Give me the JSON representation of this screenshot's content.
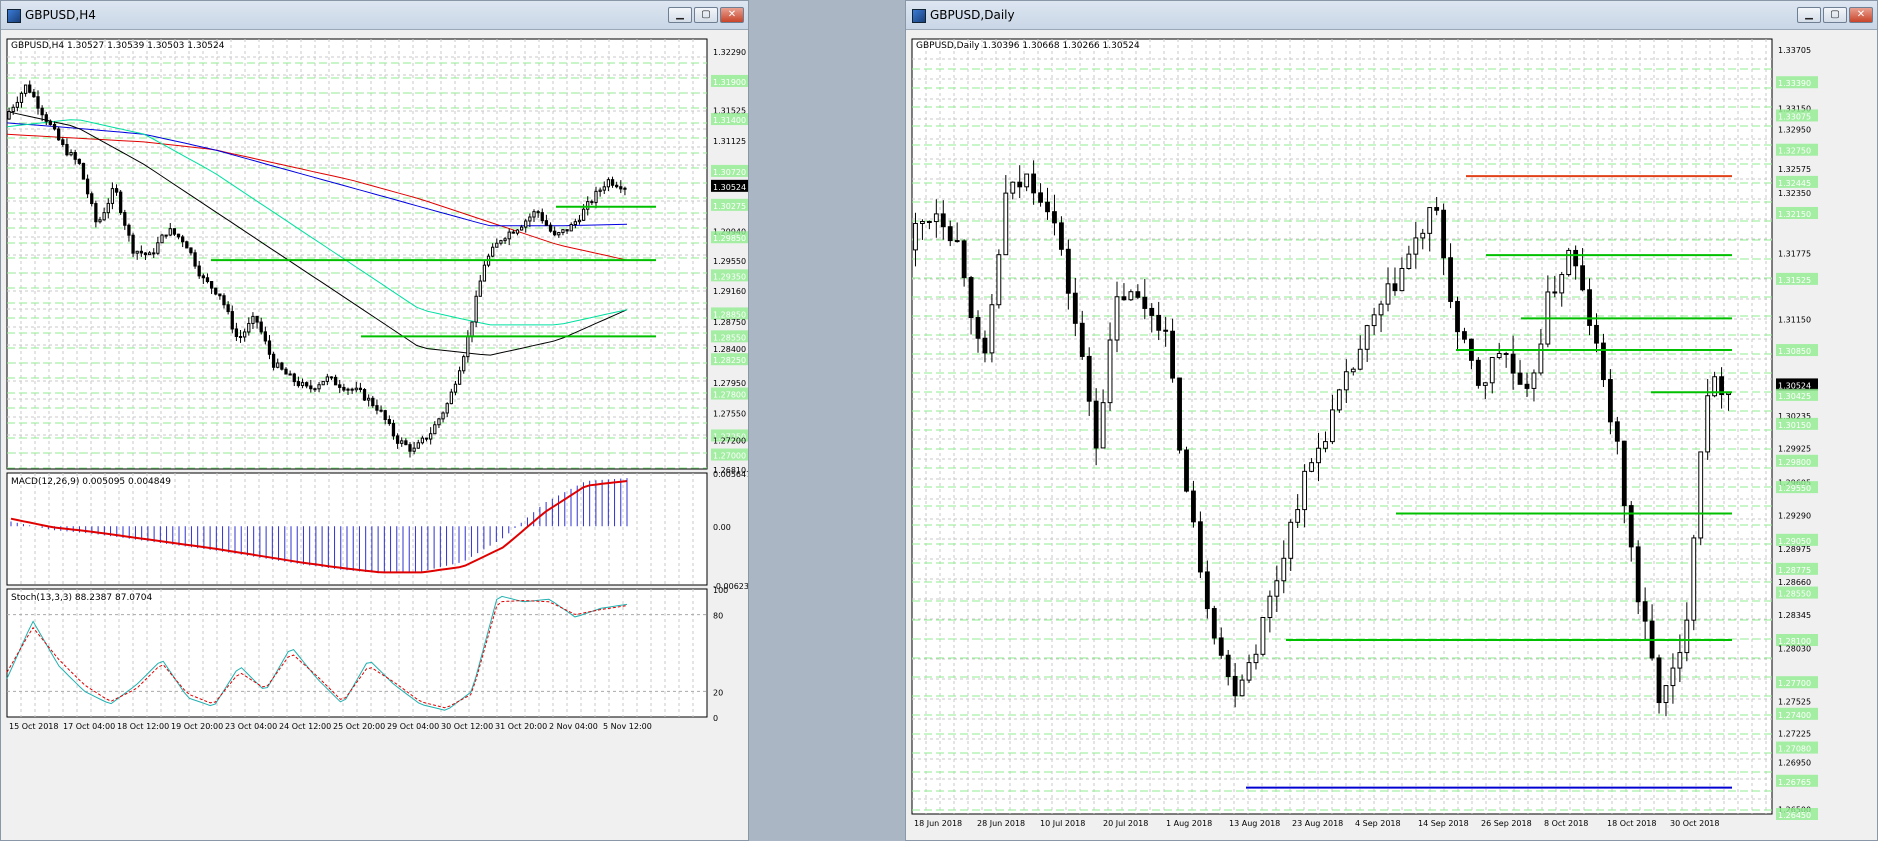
{
  "h4": {
    "title": "GBPUSD,H4",
    "header": "GBPUSD,H4  1.30527 1.30539 1.30503 1.30524",
    "price_axis": [
      "1.32290",
      "1.31900",
      "1.31525",
      "1.31400",
      "1.31125",
      "1.30720",
      "1.30524",
      "1.30275",
      "1.29940",
      "1.29850",
      "1.29550",
      "1.29350",
      "1.29160",
      "1.28850",
      "1.28750",
      "1.28550",
      "1.28400",
      "1.28250",
      "1.27950",
      "1.27800",
      "1.27550",
      "1.27250",
      "1.27200",
      "1.27000",
      "1.26810"
    ],
    "current_price": "1.30524",
    "time_axis": [
      "15 Oct 2018",
      "17 Oct 04:00",
      "18 Oct 12:00",
      "19 Oct 20:00",
      "23 Oct 04:00",
      "24 Oct 12:00",
      "25 Oct 20:00",
      "29 Oct 04:00",
      "30 Oct 12:00",
      "31 Oct 20:00",
      "2 Nov 04:00",
      "5 Nov 12:00"
    ],
    "macd_label": "MACD(12,26,9) 0.005095 0.004849",
    "macd_axis": [
      "0.005647",
      "0.00",
      "-0.006235"
    ],
    "stoch_label": "Stoch(13,3,3) 88.2387 87.0704",
    "stoch_axis": [
      "100",
      "80",
      "20",
      "0"
    ]
  },
  "daily": {
    "title": "GBPUSD,Daily",
    "header": "GBPUSD,Daily  1.30396 1.30668 1.30266 1.30524",
    "price_axis": [
      "1.33705",
      "1.33390",
      "1.33150",
      "1.33075",
      "1.32950",
      "1.32750",
      "1.32575",
      "1.32445",
      "1.32350",
      "1.32150",
      "1.31775",
      "1.31525",
      "1.31150",
      "1.30850",
      "1.30524",
      "1.30425",
      "1.30235",
      "1.30150",
      "1.29925",
      "1.29800",
      "1.29605",
      "1.29550",
      "1.29290",
      "1.29050",
      "1.28975",
      "1.28775",
      "1.28660",
      "1.28550",
      "1.28345",
      "1.28100",
      "1.28030",
      "1.27700",
      "1.27525",
      "1.27400",
      "1.27225",
      "1.27080",
      "1.26950",
      "1.26765",
      "1.26500",
      "1.26450"
    ],
    "current_price": "1.30524",
    "time_axis": [
      "18 Jun 2018",
      "28 Jun 2018",
      "10 Jul 2018",
      "20 Jul 2018",
      "1 Aug 2018",
      "13 Aug 2018",
      "23 Aug 2018",
      "4 Sep 2018",
      "14 Sep 2018",
      "26 Sep 2018",
      "8 Oct 2018",
      "18 Oct 2018",
      "30 Oct 2018"
    ]
  },
  "colors": {
    "chart_bg": "#ffffff",
    "grid": "#c8c8c8",
    "level_green": "#00c000",
    "band_green": "#90ee90",
    "resistance_red": "#e0401a",
    "support_blue": "#0000d0",
    "ma_red": "#e00000",
    "ma_blue": "#0000e0",
    "ma_black": "#000000",
    "ma_cyan": "#00e0a0",
    "macd_hist": "#3030d0",
    "macd_signal": "#e00000",
    "stoch_main": "#20b0b0",
    "stoch_signal": "#e00000"
  },
  "chart_data": [
    {
      "type": "candlestick",
      "title": "GBPUSD,H4",
      "ylim": [
        1.2681,
        1.3245
      ],
      "x": [
        "15 Oct 2018",
        "17 Oct 04:00",
        "18 Oct 12:00",
        "19 Oct 20:00",
        "23 Oct 04:00",
        "24 Oct 12:00",
        "25 Oct 20:00",
        "29 Oct 04:00",
        "30 Oct 12:00",
        "31 Oct 20:00",
        "2 Nov 04:00",
        "5 Nov 12:00"
      ],
      "close": [
        1.315,
        1.3185,
        1.3145,
        1.3105,
        1.308,
        1.3,
        1.305,
        1.297,
        1.296,
        1.2995,
        1.298,
        1.293,
        1.291,
        1.285,
        1.288,
        1.282,
        1.28,
        1.2785,
        1.28,
        1.279,
        1.278,
        1.276,
        1.272,
        1.2705,
        1.273,
        1.277,
        1.2845,
        1.295,
        1.2985,
        1.3,
        1.302,
        1.2985,
        1.3,
        1.303,
        1.306,
        1.3052
      ],
      "levels": [
        1.3025,
        1.2955,
        1.2855
      ],
      "moving_averages": [
        {
          "color": "#e00000",
          "values": [
            1.312,
            1.3115,
            1.311,
            1.31,
            1.308,
            1.306,
            1.3035,
            1.3005,
            1.2975,
            1.2955
          ]
        },
        {
          "color": "#0000e0",
          "values": [
            1.3135,
            1.3128,
            1.312,
            1.31,
            1.3075,
            1.305,
            1.3025,
            1.3,
            1.3,
            1.3002
          ]
        },
        {
          "color": "#000000",
          "values": [
            1.315,
            1.313,
            1.308,
            1.302,
            1.296,
            1.29,
            1.284,
            1.283,
            1.285,
            1.289
          ]
        },
        {
          "color": "#00e0a0",
          "values": [
            1.313,
            1.314,
            1.312,
            1.307,
            1.301,
            1.295,
            1.289,
            1.287,
            1.287,
            1.289
          ]
        }
      ],
      "macd": {
        "label": "MACD(12,26,9) 0.005095 0.004849",
        "ylim": [
          -0.006235,
          0.005647
        ],
        "hist": [
          0.0005,
          -0.0004,
          -0.0008,
          -0.0014,
          -0.002,
          -0.0026,
          -0.0033,
          -0.004,
          -0.0046,
          -0.005,
          -0.0048,
          -0.0038,
          -0.0012,
          0.0025,
          0.0048,
          0.0051
        ],
        "signal": [
          0.0008,
          -0.0001,
          -0.0006,
          -0.0012,
          -0.0018,
          -0.0024,
          -0.0031,
          -0.0038,
          -0.0044,
          -0.0049,
          -0.0049,
          -0.0043,
          -0.0022,
          0.0015,
          0.0043,
          0.0048
        ]
      },
      "stoch": {
        "label": "Stoch(13,3,3) 88.2387 87.0704",
        "ylim": [
          0,
          100
        ],
        "main": [
          30,
          75,
          40,
          20,
          10,
          25,
          45,
          15,
          8,
          40,
          20,
          55,
          30,
          10,
          45,
          25,
          10,
          5,
          20,
          95,
          90,
          92,
          78,
          85,
          88
        ],
        "signal": [
          35,
          70,
          45,
          25,
          12,
          22,
          42,
          18,
          10,
          35,
          22,
          50,
          32,
          12,
          40,
          27,
          12,
          7,
          18,
          90,
          91,
          90,
          80,
          84,
          87
        ]
      }
    },
    {
      "type": "candlestick",
      "title": "GBPUSD,Daily",
      "ylim": [
        1.2645,
        1.338
      ],
      "x": [
        "18 Jun 2018",
        "28 Jun 2018",
        "10 Jul 2018",
        "20 Jul 2018",
        "1 Aug 2018",
        "13 Aug 2018",
        "23 Aug 2018",
        "4 Sep 2018",
        "14 Sep 2018",
        "26 Sep 2018",
        "8 Oct 2018",
        "18 Oct 2018",
        "30 Oct 2018"
      ],
      "close": [
        1.32,
        1.322,
        1.318,
        1.306,
        1.323,
        1.325,
        1.322,
        1.312,
        1.3,
        1.314,
        1.313,
        1.311,
        1.295,
        1.284,
        1.276,
        1.28,
        1.287,
        1.295,
        1.3,
        1.305,
        1.31,
        1.314,
        1.318,
        1.322,
        1.31,
        1.305,
        1.309,
        1.303,
        1.313,
        1.318,
        1.31,
        1.3,
        1.285,
        1.275,
        1.28,
        1.305,
        1.3052
      ],
      "levels_green": [
        1.3175,
        1.3115,
        1.3085,
        1.3045,
        1.293,
        1.281
      ],
      "resistance_red": 1.325,
      "support_blue": 1.267
    }
  ]
}
